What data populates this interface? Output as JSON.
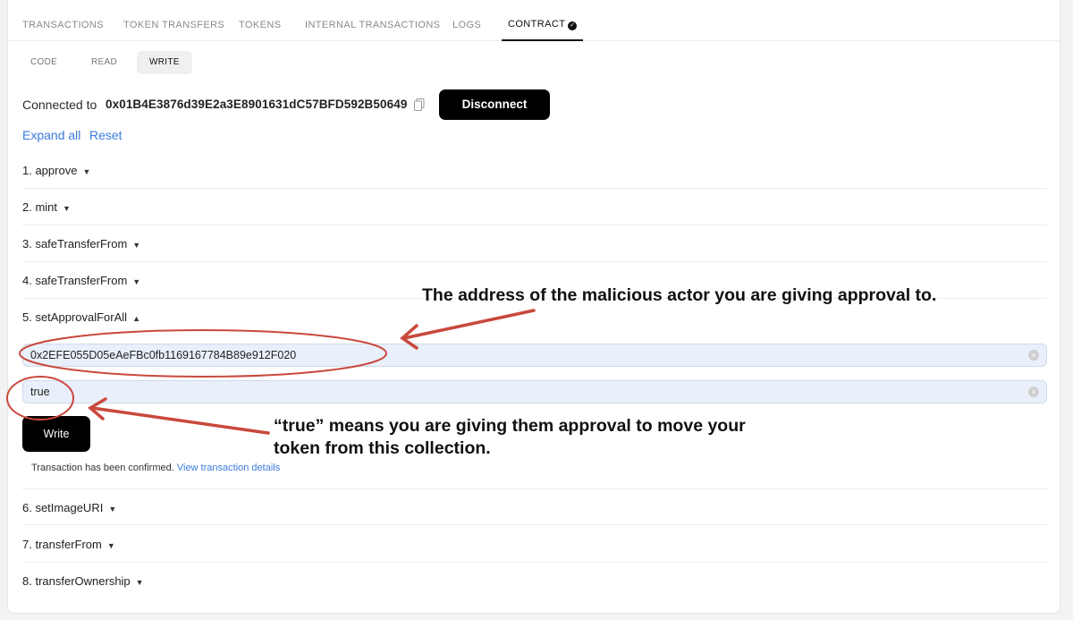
{
  "tabs": [
    "TRANSACTIONS",
    "TOKEN TRANSFERS",
    "TOKENS",
    "INTERNAL TRANSACTIONS",
    "LOGS",
    "CONTRACT"
  ],
  "subtabs": [
    "CODE",
    "READ",
    "WRITE"
  ],
  "connection": {
    "label": "Connected to",
    "address": "0x01B4E3876d39E2a3E8901631dC57BFD592B50649",
    "disconnect_label": "Disconnect"
  },
  "links": {
    "expand_all": "Expand all",
    "reset": "Reset"
  },
  "methods": [
    "1. approve",
    "2. mint",
    "3. safeTransferFrom",
    "4. safeTransferFrom",
    "5. setApprovalForAll",
    "6. setImageURI",
    "7. transferFrom",
    "8. transferOwnership"
  ],
  "inputs": {
    "operator_value": "0x2EFE055D05eAeFBc0fb1169167784B89e912F020",
    "approved_value": "true"
  },
  "write_label": "Write",
  "confirmation": {
    "text": "Transaction has been confirmed.",
    "link": "View transaction details"
  },
  "annotations": {
    "address_note": "The address of the malicious actor you are giving approval to.",
    "true_note_line1": "“true” means you are giving them approval to move your",
    "true_note_line2": "token from this collection."
  },
  "colors": {
    "accent_link": "#3a7bdc",
    "annotation_red": "#c9483c",
    "input_bg": "#e9f0fb"
  }
}
